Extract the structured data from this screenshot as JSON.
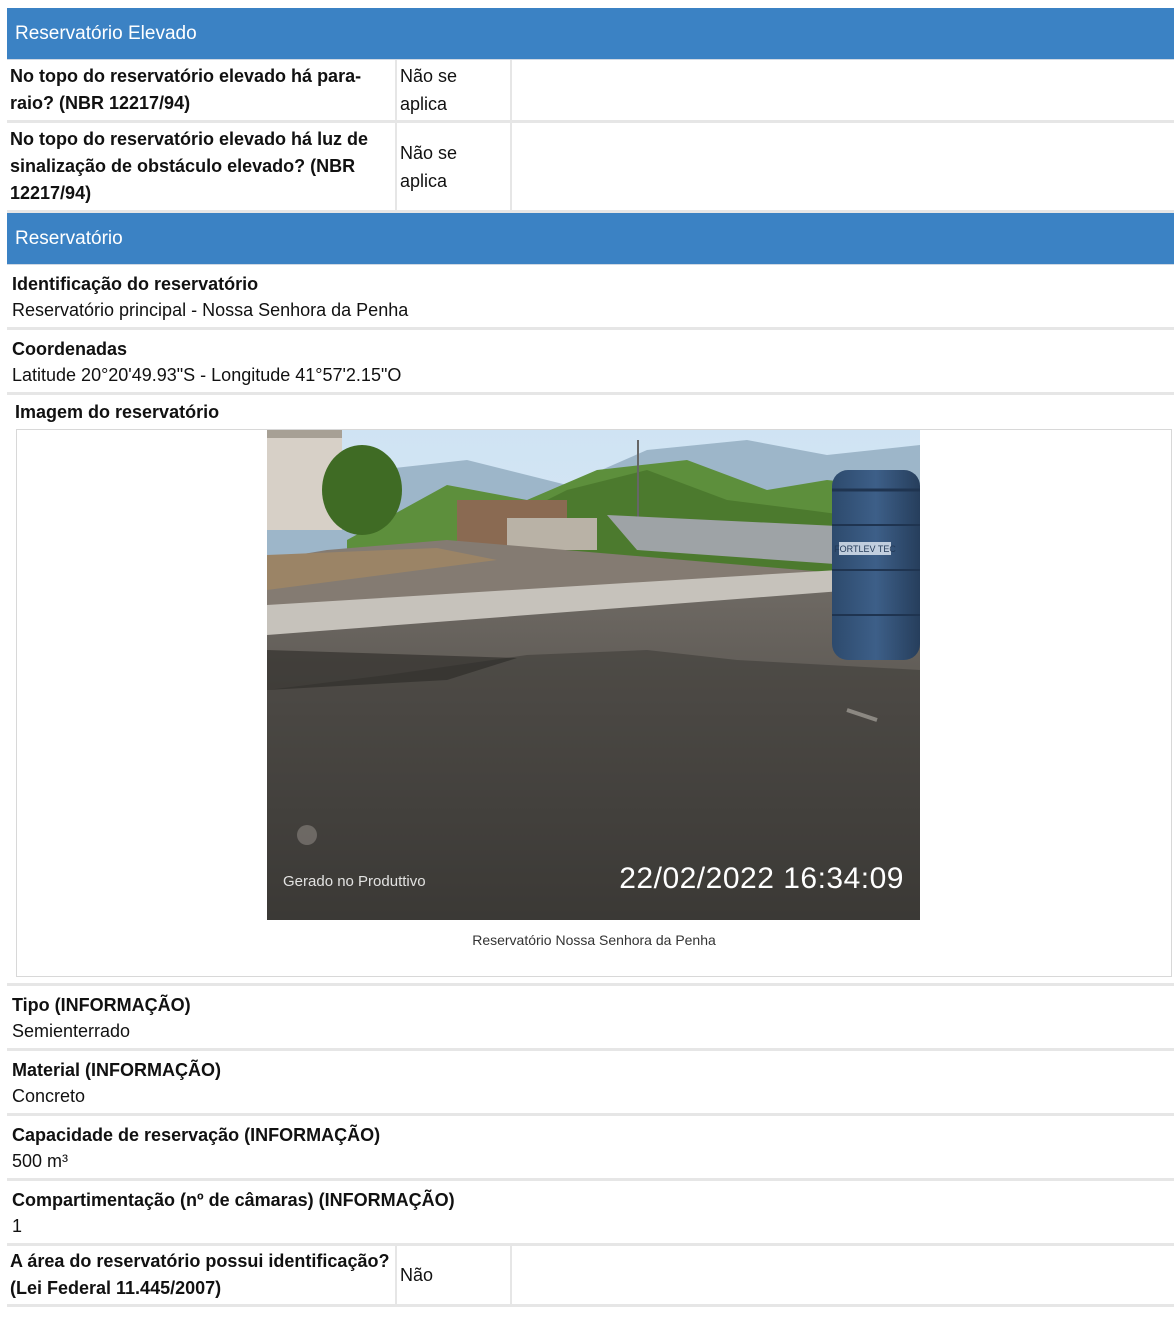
{
  "sections": {
    "elevated": {
      "title": "Reservatório Elevado",
      "rows": [
        {
          "question": "No topo do reservatório elevado há para-raio? (NBR 12217/94)",
          "answer": "Não se aplica"
        },
        {
          "question": "No topo do reservatório elevado há luz de sinalização de obstáculo elevado? (NBR 12217/94)",
          "answer": "Não se aplica"
        }
      ]
    },
    "reservoir": {
      "title": "Reservatório",
      "identification": {
        "label": "Identificação do reservatório",
        "value": "Reservatório principal - Nossa Senhora da Penha"
      },
      "coordinates": {
        "label": "Coordenadas",
        "value": "Latitude 20°20'49.93\"S - Longitude 41°57'2.15\"O"
      },
      "image": {
        "label": "Imagem do reservatório",
        "watermark": "Gerado no Produttivo",
        "timestamp": "22/02/2022 16:34:09",
        "tank_brand": "FORTLEV TEC",
        "caption": "Reservatório Nossa Senhora da Penha"
      },
      "type": {
        "label": "Tipo (INFORMAÇÃO)",
        "value": "Semienterrado"
      },
      "material": {
        "label": "Material (INFORMAÇÃO)",
        "value": "Concreto"
      },
      "capacity": {
        "label": "Capacidade de reservação (INFORMAÇÃO)",
        "value": "500 m³"
      },
      "chambers": {
        "label": "Compartimentação (nº de câmaras) (INFORMAÇÃO)",
        "value": "1"
      },
      "signage": {
        "question": "A área do reservatório possui identificação? (Lei Federal 11.445/2007)",
        "answer": "Não"
      }
    }
  },
  "colors": {
    "header_bg": "#3b82c4",
    "divider": "#e6e6e6"
  }
}
